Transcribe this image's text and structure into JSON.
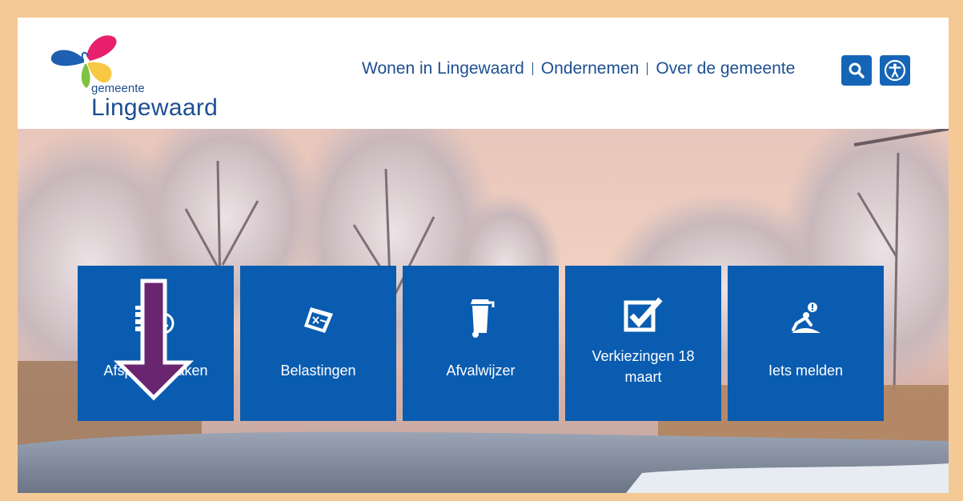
{
  "header": {
    "logo": {
      "small_text": "gemeente",
      "name": "Lingewaard"
    },
    "nav": [
      {
        "label": "Wonen in Lingewaard"
      },
      {
        "label": "Ondernemen"
      },
      {
        "label": "Over de gemeente"
      }
    ],
    "search_icon": "search-icon",
    "accessibility_icon": "accessibility-icon"
  },
  "tiles": [
    {
      "label": "Afspraak maken",
      "icon": "calendar-clock-icon"
    },
    {
      "label": "Belastingen",
      "icon": "tax-ticket-icon"
    },
    {
      "label": "Afvalwijzer",
      "icon": "waste-bin-icon"
    },
    {
      "label": "Verkiezingen 18 maart",
      "icon": "ballot-check-icon"
    },
    {
      "label": "Iets melden",
      "icon": "report-issue-icon"
    }
  ],
  "annotation": {
    "icon": "down-arrow-icon",
    "color": "#6a2570"
  },
  "colors": {
    "brand_blue": "#1d4f91",
    "tile_blue": "#0a5cb0",
    "button_blue": "#1565b6",
    "frame": "#f5c995"
  }
}
